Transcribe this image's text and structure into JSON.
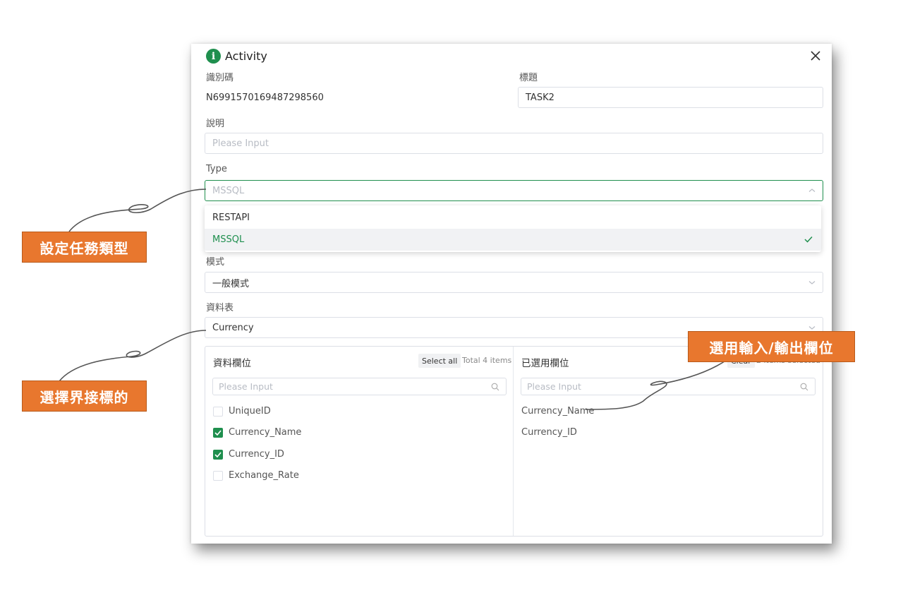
{
  "dialog": {
    "title": "Activity"
  },
  "fields": {
    "id": {
      "label": "識別碼",
      "value": "N6991570169487298560"
    },
    "title": {
      "label": "標題",
      "value": "TASK2"
    },
    "description": {
      "label": "說明",
      "placeholder": "Please Input"
    },
    "type": {
      "label": "Type",
      "value": "MSSQL",
      "options": [
        "RESTAPI",
        "MSSQL"
      ],
      "selected": "MSSQL"
    },
    "mode": {
      "label": "模式",
      "value": "一般模式"
    },
    "table": {
      "label": "資料表",
      "value": "Currency"
    }
  },
  "transfer": {
    "left": {
      "title": "資料欄位",
      "select_all": "Select all",
      "total": "Total 4 items",
      "search_placeholder": "Please Input",
      "items": [
        {
          "label": "UniqueID",
          "checked": false
        },
        {
          "label": "Currency_Name",
          "checked": true
        },
        {
          "label": "Currency_ID",
          "checked": true
        },
        {
          "label": "Exchange_Rate",
          "checked": false
        }
      ]
    },
    "right": {
      "title": "已選用欄位",
      "clear": "Clear",
      "total": "2 items selected",
      "search_placeholder": "Please Input",
      "items": [
        "Currency_Name",
        "Currency_ID"
      ]
    }
  },
  "callouts": {
    "type": "設定任務類型",
    "table": "選擇界接標的",
    "fields": "選用輸入/輸出欄位"
  },
  "colors": {
    "accent": "#1f8f4e",
    "callout": "#e8772e"
  }
}
